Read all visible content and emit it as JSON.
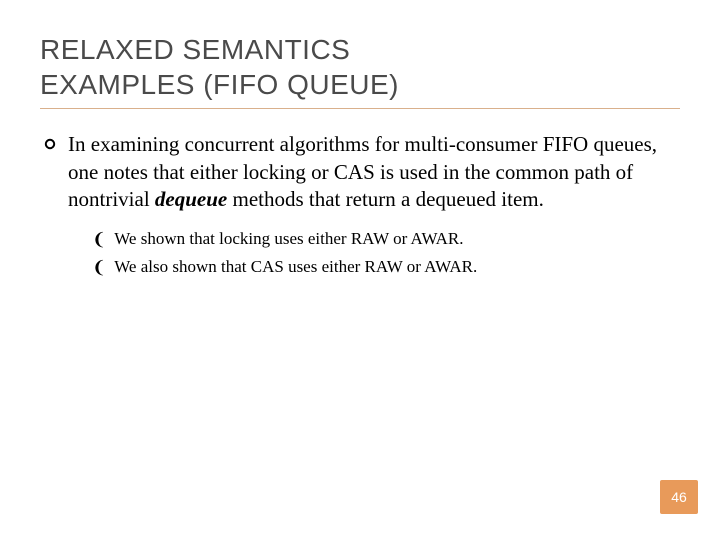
{
  "title_line1": "RELAXED SEMANTICS",
  "title_line2": "EXAMPLES (FIFO QUEUE)",
  "main_bullet": {
    "pre": "In examining concurrent algorithms for multi-consumer FIFO queues, one notes that either locking or CAS is used in the common path of nontrivial ",
    "strong": "dequeue",
    "post": " methods that return a dequeued item."
  },
  "sub_bullets": [
    "We shown that locking uses either RAW or AWAR.",
    "We also shown that CAS uses either RAW or AWAR."
  ],
  "page_number": "46",
  "colors": {
    "accent": "#e89a5a",
    "rule": "#d9b08c",
    "title": "#4a4a4a"
  }
}
